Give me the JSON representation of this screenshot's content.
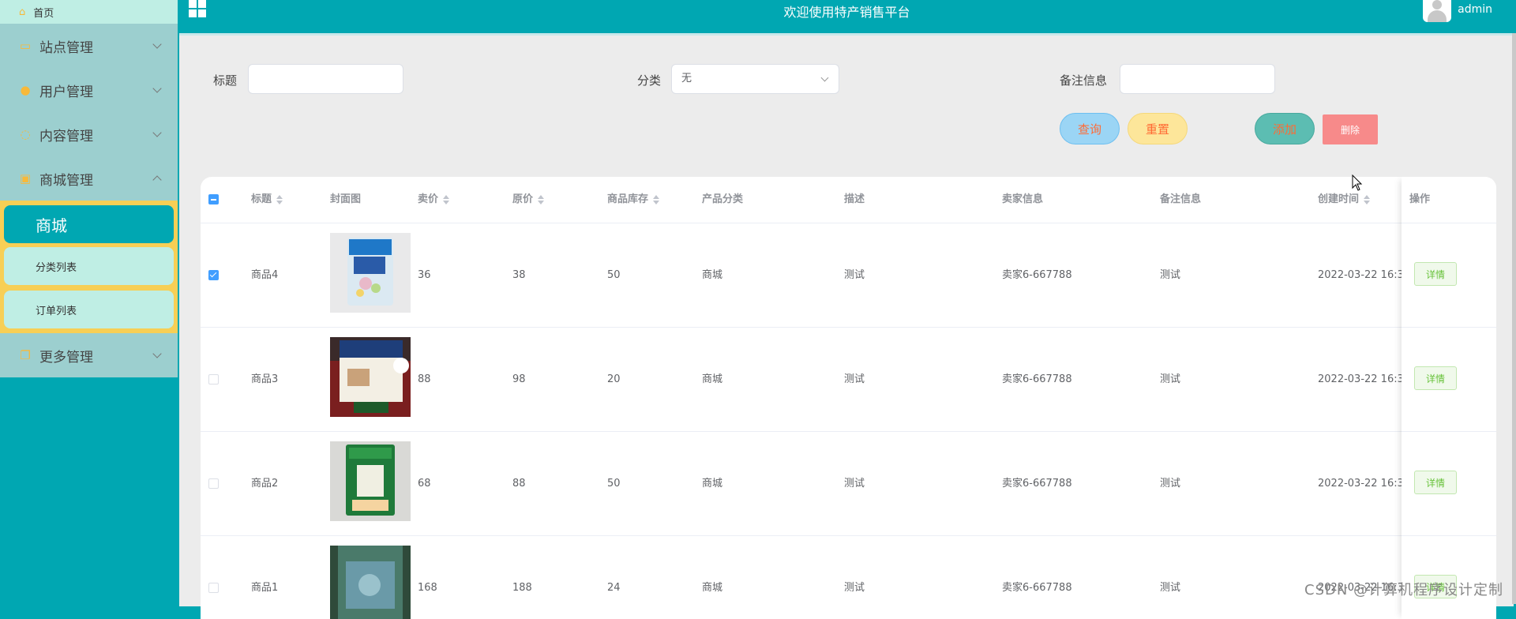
{
  "sidebar": {
    "home": "首页",
    "menus": [
      {
        "label": "站点管理",
        "icon": "monitor-icon"
      },
      {
        "label": "用户管理",
        "icon": "user-icon"
      },
      {
        "label": "内容管理",
        "icon": "chat-icon"
      },
      {
        "label": "商城管理",
        "icon": "lock-icon"
      }
    ],
    "shop_sub": {
      "active": "商城",
      "items": [
        "分类列表",
        "订单列表"
      ]
    },
    "more": "更多管理"
  },
  "header": {
    "title": "欢迎使用特产销售平台",
    "username": "admin"
  },
  "search": {
    "title_label": "标题",
    "category_label": "分类",
    "category_value": "无",
    "remark_label": "备注信息",
    "query_btn": "查询",
    "reset_btn": "重置",
    "add_btn": "添加",
    "delete_btn": "删除"
  },
  "table": {
    "headers": [
      "标题",
      "封面图",
      "卖价",
      "原价",
      "商品库存",
      "产品分类",
      "描述",
      "卖家信息",
      "备注信息",
      "创建时间",
      "操作"
    ],
    "rows": [
      {
        "title": "商品4",
        "price": "36",
        "orig": "38",
        "stock": "50",
        "category": "商城",
        "desc": "测试",
        "seller": "卖家6-667788",
        "remark": "测试",
        "created": "2022-03-22 16:3",
        "action": "详情",
        "checked": true
      },
      {
        "title": "商品3",
        "price": "88",
        "orig": "98",
        "stock": "20",
        "category": "商城",
        "desc": "测试",
        "seller": "卖家6-667788",
        "remark": "测试",
        "created": "2022-03-22 16:3",
        "action": "详情",
        "checked": false
      },
      {
        "title": "商品2",
        "price": "68",
        "orig": "88",
        "stock": "50",
        "category": "商城",
        "desc": "测试",
        "seller": "卖家6-667788",
        "remark": "测试",
        "created": "2022-03-22 16:3",
        "action": "详情",
        "checked": false
      },
      {
        "title": "商品1",
        "price": "168",
        "orig": "188",
        "stock": "24",
        "category": "商城",
        "desc": "测试",
        "seller": "卖家6-667788",
        "remark": "测试",
        "created": "2022-03-22 16:3",
        "action": "详情",
        "checked": false
      }
    ]
  },
  "watermark": "CSDN @计算机程序设计定制",
  "colors": {
    "primary": "#00a7b2",
    "query_btn": "#9bd5f5",
    "reset_btn": "#fde69a",
    "add_btn": "#5cbdb2",
    "delete_btn": "#f78a8a"
  }
}
